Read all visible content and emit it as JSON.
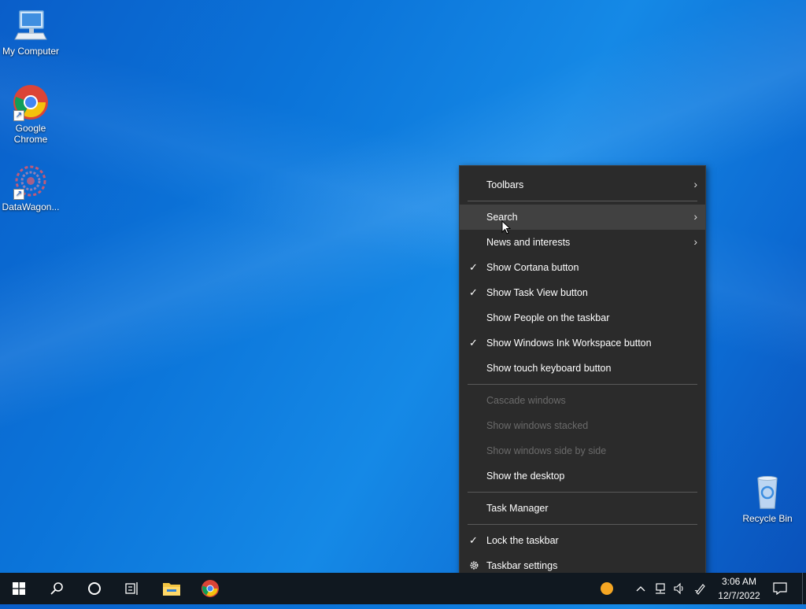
{
  "desktop": {
    "icons": [
      {
        "label": "My Computer"
      },
      {
        "label": "Google Chrome"
      },
      {
        "label": "DataWagon..."
      },
      {
        "label": "Recycle Bin"
      }
    ]
  },
  "context_menu": {
    "items": [
      {
        "label": "Toolbars",
        "submenu": true
      },
      {
        "label": "Search",
        "submenu": true,
        "hover": true
      },
      {
        "label": "News and interests",
        "submenu": true
      },
      {
        "label": "Show Cortana button",
        "checked": true
      },
      {
        "label": "Show Task View button",
        "checked": true
      },
      {
        "label": "Show People on the taskbar"
      },
      {
        "label": "Show Windows Ink Workspace button",
        "checked": true
      },
      {
        "label": "Show touch keyboard button"
      },
      {
        "label": "Cascade windows",
        "disabled": true
      },
      {
        "label": "Show windows stacked",
        "disabled": true
      },
      {
        "label": "Show windows side by side",
        "disabled": true
      },
      {
        "label": "Show the desktop"
      },
      {
        "label": "Task Manager"
      },
      {
        "label": "Lock the taskbar",
        "checked": true
      },
      {
        "label": "Taskbar settings",
        "icon": "gear-icon"
      }
    ],
    "check_glyph": "✓",
    "arrow_glyph": "›"
  },
  "taskbar": {
    "clock_time": "3:06 AM",
    "clock_date": "12/7/2022"
  }
}
